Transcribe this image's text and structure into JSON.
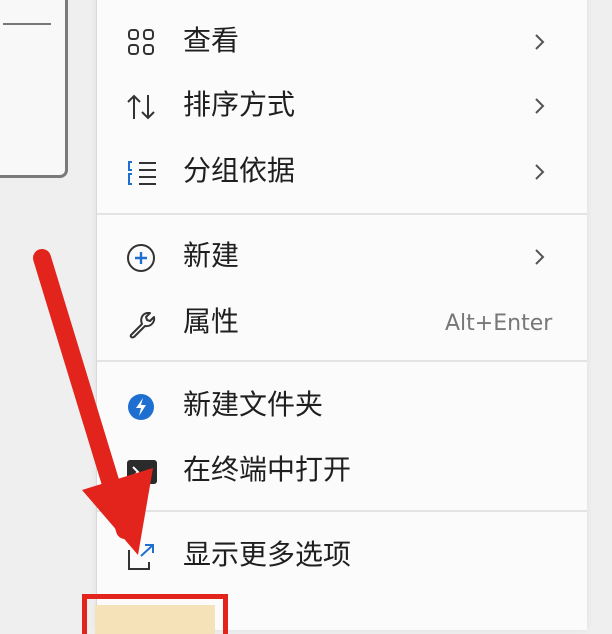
{
  "menu": {
    "items": [
      {
        "label": "查看",
        "icon": "grid-view-icon",
        "has_submenu": true
      },
      {
        "label": "排序方式",
        "icon": "sort-arrows-icon",
        "has_submenu": true
      },
      {
        "label": "分组依据",
        "icon": "group-list-icon",
        "has_submenu": true
      },
      {
        "label": "新建",
        "icon": "plus-circle-icon",
        "has_submenu": true
      },
      {
        "label": "属性",
        "icon": "wrench-icon",
        "shortcut": "Alt+Enter"
      },
      {
        "label": "新建文件夹",
        "icon": "lightning-badge-icon"
      },
      {
        "label": "在终端中打开",
        "icon": "terminal-icon"
      },
      {
        "label": "显示更多选项",
        "icon": "show-more-options-icon"
      }
    ]
  },
  "colors": {
    "accent_blue": "#1f6fd1",
    "annotation_red": "#e2241c",
    "menu_background": "#fbfbfb",
    "page_background": "#efefef"
  }
}
